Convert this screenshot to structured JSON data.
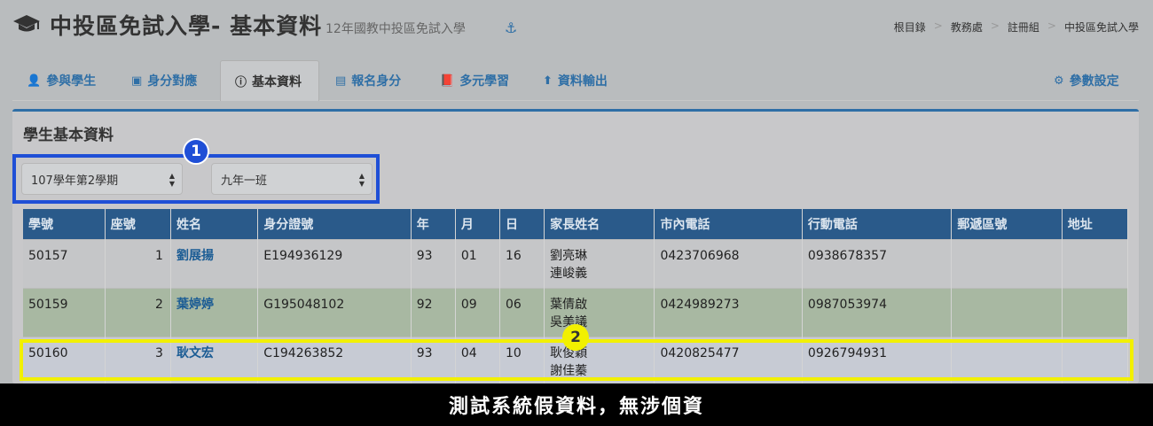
{
  "header": {
    "title": "中投區免試入學- 基本資料",
    "subtitle": "12年國教中投區免試入學",
    "icon": "graduation-cap-icon",
    "breadcrumb": [
      "根目錄",
      "教務處",
      "註冊組",
      "中投區免試入學"
    ]
  },
  "tabs": [
    {
      "label": "參與學生",
      "icon": "user-plus-icon"
    },
    {
      "label": "身分對應",
      "icon": "id-badge-icon"
    },
    {
      "label": "基本資料",
      "icon": "info-circle-icon",
      "active": true
    },
    {
      "label": "報名身分",
      "icon": "id-card-icon"
    },
    {
      "label": "多元學習",
      "icon": "book-icon"
    },
    {
      "label": "資料輸出",
      "icon": "upload-icon"
    },
    {
      "label": "參數設定",
      "icon": "gear-icon"
    }
  ],
  "panel": {
    "title": "學生基本資料",
    "term_select": "107學年第2學期",
    "class_select": "九年一班"
  },
  "callouts": {
    "one": "1",
    "two": "2"
  },
  "table": {
    "columns": [
      "學號",
      "座號",
      "姓名",
      "身分證號",
      "年",
      "月",
      "日",
      "家長姓名",
      "市內電話",
      "行動電話",
      "郵遞區號",
      "地址"
    ],
    "rows": [
      {
        "id": "50157",
        "seat": "1",
        "name": "劉展揚",
        "nid": "E194936129",
        "y": "93",
        "m": "01",
        "d": "16",
        "parent1": "劉亮琳",
        "parent2": "連峻義",
        "tel": "0423706968",
        "mobile": "0938678357",
        "zip": "",
        "addr": ""
      },
      {
        "id": "50159",
        "seat": "2",
        "name": "葉婷婷",
        "nid": "G195048102",
        "y": "92",
        "m": "09",
        "d": "06",
        "parent1": "葉倩啟",
        "parent2": "吳美議",
        "tel": "0424989273",
        "mobile": "0987053974",
        "zip": "",
        "addr": ""
      },
      {
        "id": "50160",
        "seat": "3",
        "name": "耿文宏",
        "nid": "C194263852",
        "y": "93",
        "m": "04",
        "d": "10",
        "parent1": "耿俊穎",
        "parent2": "謝佳蓁",
        "tel": "0420825477",
        "mobile": "0926794931",
        "zip": "",
        "addr": ""
      }
    ]
  },
  "footer": {
    "text": "測試系統假資料，無涉個資"
  },
  "colors": {
    "accent": "#2f6fa6",
    "callout1": "#1f4fd6",
    "callout2": "#f2f000"
  }
}
